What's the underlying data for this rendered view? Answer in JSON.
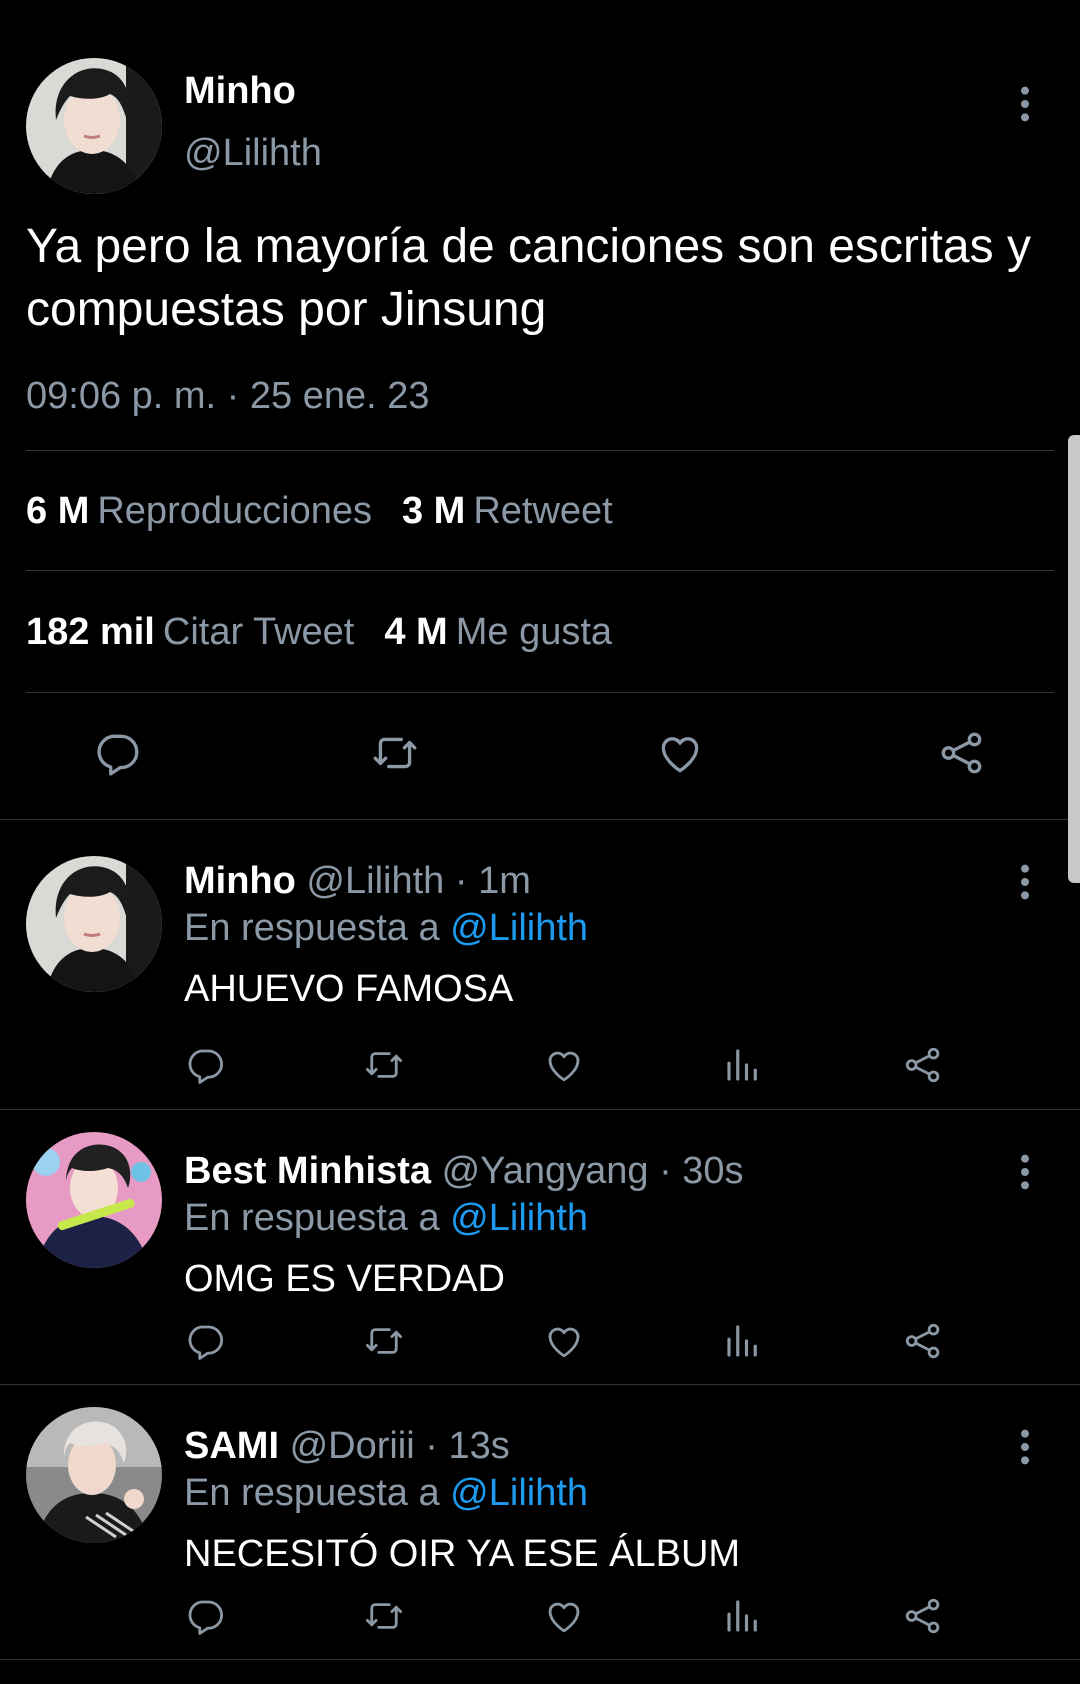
{
  "main_tweet": {
    "display_name": "Minho",
    "handle": "@Lilihth",
    "text": "Ya pero la mayoría de canciones son escritas y compuestas por Jinsung",
    "timestamp": "09:06 p. m. · 25 ene. 23",
    "stats": {
      "views_count": "6 M",
      "views_label": "Reproducciones",
      "retweets_count": "3 M",
      "retweets_label": "Retweet",
      "quotes_count": "182 mil",
      "quotes_label": "Citar Tweet",
      "likes_count": "4 M",
      "likes_label": "Me gusta"
    },
    "actions": [
      "reply-icon",
      "retweet-icon",
      "like-icon",
      "share-icon"
    ]
  },
  "replies": [
    {
      "display_name": "Minho",
      "handle": "@Lilihth",
      "time": "· 1m",
      "reply_to_label": "En respuesta a",
      "reply_to_handle": "@Lilihth",
      "text": "AHUEVO FAMOSA"
    },
    {
      "display_name": "Best Minhista",
      "handle": "@Yangyang",
      "time": "· 30s",
      "reply_to_label": "En respuesta a",
      "reply_to_handle": "@Lilihth",
      "text": "OMG ES VERDAD"
    },
    {
      "display_name": "SAMI",
      "handle": "@Doriii",
      "time": "· 13s",
      "reply_to_label": "En respuesta a",
      "reply_to_handle": "@Lilihth",
      "text": "NECESITÓ OIR YA ESE ÁLBUM"
    }
  ],
  "reply_actions": [
    "reply-icon",
    "retweet-icon",
    "like-icon",
    "views-icon",
    "share-icon"
  ],
  "colors": {
    "background": "#000000",
    "text_primary": "#ffffff",
    "text_secondary": "#8b98a5",
    "link": "#1d9bf0",
    "divider": "#2f3336"
  }
}
